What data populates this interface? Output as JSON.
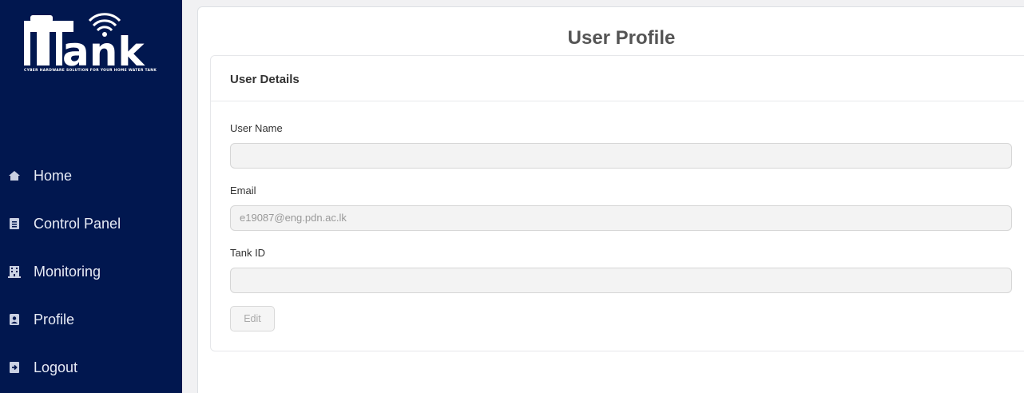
{
  "brand": {
    "name": "Tank",
    "tagline": "CYBER HARDWARE SOLUTION FOR YOUR HOME WATER TANK"
  },
  "sidebar": {
    "items": [
      {
        "label": "Home",
        "icon": "home-icon"
      },
      {
        "label": "Control Panel",
        "icon": "clipboard-icon"
      },
      {
        "label": "Monitoring",
        "icon": "building-icon"
      },
      {
        "label": "Profile",
        "icon": "id-badge-icon"
      },
      {
        "label": "Logout",
        "icon": "logout-icon"
      }
    ]
  },
  "page": {
    "title": "User Profile"
  },
  "details": {
    "title": "User Details",
    "fields": [
      {
        "label": "User Name",
        "value": ""
      },
      {
        "label": "Email",
        "value": "e19087@eng.pdn.ac.lk"
      },
      {
        "label": "Tank ID",
        "value": ""
      }
    ],
    "edit_label": "Edit"
  },
  "colors": {
    "sidebar_bg": "#01174f",
    "page_bg": "#f1f1f3",
    "title_text": "#555555"
  }
}
